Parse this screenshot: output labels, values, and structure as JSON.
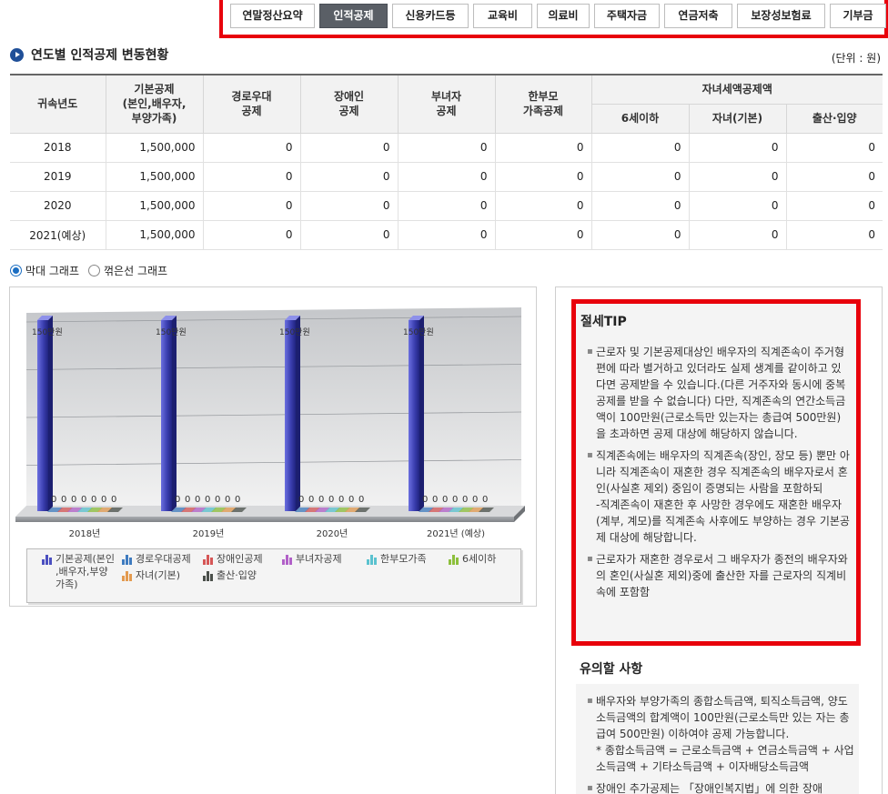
{
  "tabs": [
    {
      "label": "연말정산요약",
      "active": false
    },
    {
      "label": "인적공제",
      "active": true
    },
    {
      "label": "신용카드등",
      "active": false
    },
    {
      "label": "교육비",
      "active": false
    },
    {
      "label": "의료비",
      "active": false
    },
    {
      "label": "주택자금",
      "active": false
    },
    {
      "label": "연금저축",
      "active": false
    },
    {
      "label": "보장성보험료",
      "active": false
    },
    {
      "label": "기부금",
      "active": false
    }
  ],
  "page_title": "연도별 인적공제 변동현황",
  "unit_label": "(단위 : 원)",
  "table": {
    "headers": {
      "year": "귀속년도",
      "basic": "기본공제\n(본인,배우자,\n부양가족)",
      "elderly": "경로우대\n공제",
      "disabled": "장애인\n공제",
      "woman": "부녀자\n공제",
      "single_parent": "한부모\n가족공제",
      "child_group": "자녀세액공제액",
      "under6": "6세이하",
      "child_basic": "자녀(기본)",
      "birth": "출산·입양"
    },
    "rows": [
      [
        "2018",
        "1,500,000",
        "0",
        "0",
        "0",
        "0",
        "0",
        "0",
        "0"
      ],
      [
        "2019",
        "1,500,000",
        "0",
        "0",
        "0",
        "0",
        "0",
        "0",
        "0"
      ],
      [
        "2020",
        "1,500,000",
        "0",
        "0",
        "0",
        "0",
        "0",
        "0",
        "0"
      ],
      [
        "2021(예상)",
        "1,500,000",
        "0",
        "0",
        "0",
        "0",
        "0",
        "0",
        "0"
      ]
    ]
  },
  "graph_options": {
    "bar_label": "막대 그래프",
    "line_label": "꺾은선 그래프",
    "selected": "bar"
  },
  "chart_data": {
    "type": "bar",
    "categories": [
      "2018년",
      "2019년",
      "2020년",
      "2021년 (예상)"
    ],
    "series": [
      {
        "name": "기본공제(본인,배우자,부양가족)",
        "values": [
          150,
          150,
          150,
          150
        ],
        "labels": [
          "150만원",
          "150만원",
          "150만원",
          "150만원"
        ],
        "color": "#4b4fc0"
      },
      {
        "name": "경로우대공제",
        "values": [
          0,
          0,
          0,
          0
        ],
        "labels": [
          "0",
          "0",
          "0",
          "0"
        ],
        "color": "#3f7bbf"
      },
      {
        "name": "장애인공제",
        "values": [
          0,
          0,
          0,
          0
        ],
        "labels": [
          "0",
          "0",
          "0",
          "0"
        ],
        "color": "#d65656"
      },
      {
        "name": "부녀자공제",
        "values": [
          0,
          0,
          0,
          0
        ],
        "labels": [
          "0",
          "0",
          "0",
          "0"
        ],
        "color": "#b160c8"
      },
      {
        "name": "한부모가족",
        "values": [
          0,
          0,
          0,
          0
        ],
        "labels": [
          "0",
          "0",
          "0",
          "0"
        ],
        "color": "#5bc2cf"
      },
      {
        "name": "6세이하",
        "values": [
          0,
          0,
          0,
          0
        ],
        "labels": [
          "0",
          "0",
          "0",
          "0"
        ],
        "color": "#8dbf3c"
      },
      {
        "name": "자녀(기본)",
        "values": [
          0,
          0,
          0,
          0
        ],
        "labels": [
          "0",
          "0",
          "0",
          "0"
        ],
        "color": "#e39a4f"
      },
      {
        "name": "출산·입양",
        "values": [
          0,
          0,
          0,
          0
        ],
        "labels": [
          "0",
          "0",
          "0",
          "0"
        ],
        "color": "#4a4f4a"
      }
    ],
    "ylim": [
      0,
      150
    ],
    "legend_position": "bottom",
    "grid": true
  },
  "legend_display": {
    "basic": "기본공제(본인\n,배우자,부양\n가족)"
  },
  "tip": {
    "title": "절세TIP",
    "items": [
      "근로자 및 기본공제대상인 배우자의 직계존속이 주거형편에 따라 별거하고 있더라도 실제 생계를 같이하고 있다면 공제받을 수 있습니다.(다른 거주자와 동시에 중복공제를 받을 수 없습니다) 다만, 직계존속의 연간소득금액이 100만원(근로소득만 있는자는 총급여 500만원)을 초과하면 공제 대상에 해당하지 않습니다.",
      "직계존속에는 배우자의 직계존속(장인, 장모 등) 뿐만 아니라 직계존속이 재혼한 경우 직계존속의 배우자로서 혼인(사실혼 제외) 중임이 증명되는 사람을 포함하되\n-직계존속이 재혼한 후 사망한 경우에도 재혼한 배우자(계부, 계모)를 직계존속 사후에도 부양하는 경우 기본공제 대상에 해당합니다.",
      "근로자가 재혼한 경우로서 그 배우자가 종전의 배우자와의 혼인(사실혼 제외)중에 출산한 자를 근로자의 직계비속에 포함함"
    ]
  },
  "notice": {
    "title": "유의할 사항",
    "items": [
      "배우자와 부양가족의 종합소득금액, 퇴직소득금액, 양도소득금액의 합계액이 100만원(근로소득만 있는 자는 총급여 500만원) 이하여야 공제 가능합니다.\n* 종합소득금액 = 근로소득금액 + 연금소득금액 + 사업소득금액 + 기타소득금액 + 이자배당소득금액",
      "장애인 추가공제는 「장애인복지법」에 의한 장애"
    ]
  }
}
